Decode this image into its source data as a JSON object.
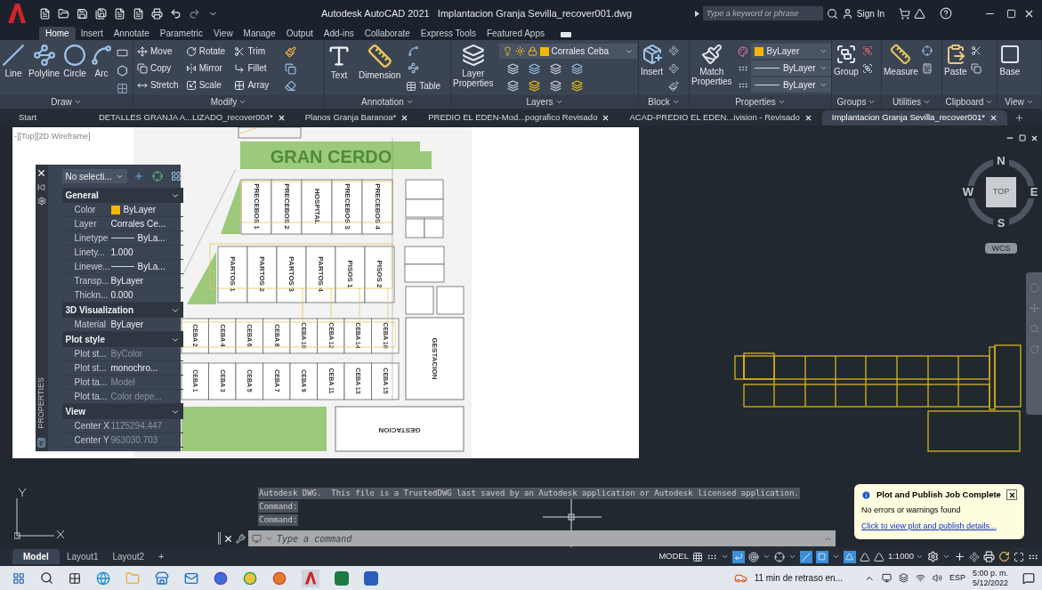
{
  "window": {
    "title": "Autodesk AutoCAD 2021   Implantacion Granja Sevilla_recover001.dwg",
    "search": {
      "placeholder": "Type a keyword or phrase"
    },
    "sign_in": "Sign In"
  },
  "ribbon": {
    "tabs": [
      {
        "label": "Home",
        "selected": true
      },
      {
        "label": "Insert",
        "selected": false
      },
      {
        "label": "Annotate",
        "selected": false
      },
      {
        "label": "Parametric",
        "selected": false
      },
      {
        "label": "View",
        "selected": false
      },
      {
        "label": "Manage",
        "selected": false
      },
      {
        "label": "Output",
        "selected": false
      },
      {
        "label": "Add-ins",
        "selected": false
      },
      {
        "label": "Collaborate",
        "selected": false
      },
      {
        "label": "Express Tools",
        "selected": false
      },
      {
        "label": "Featured Apps",
        "selected": false
      }
    ],
    "panels": [
      {
        "kind": "draw",
        "title": "Draw",
        "tools": [
          "Line",
          "Polyline",
          "Circle",
          "Arc"
        ]
      },
      {
        "kind": "modify",
        "title": "Modify",
        "tools": [
          "Move",
          "Rotate",
          "Trim",
          "Copy",
          "Mirror",
          "Fillet",
          "Stretch",
          "Scale",
          "Array"
        ]
      },
      {
        "kind": "annotation",
        "title": "Annotation",
        "tools": [
          "Text",
          "Dimension",
          "Table"
        ]
      },
      {
        "kind": "layers",
        "title": "Layers",
        "tools": [
          "Layer Properties"
        ],
        "layer": "Corrales Ceba"
      },
      {
        "kind": "block",
        "title": "Block",
        "tools": [
          "Insert"
        ]
      },
      {
        "kind": "properties",
        "title": "Properties",
        "tools": [
          "Match Properties"
        ],
        "dropdowns": [
          "ByLayer",
          "ByLayer",
          "ByLayer"
        ]
      },
      {
        "kind": "groups",
        "title": "Groups",
        "tools": [
          "Group"
        ]
      },
      {
        "kind": "utilities",
        "title": "Utilities",
        "tools": [
          "Measure"
        ]
      },
      {
        "kind": "clipboard",
        "title": "Clipboard",
        "tools": [
          "Paste"
        ]
      },
      {
        "kind": "view",
        "title": "View",
        "tools": [
          "Base"
        ]
      }
    ]
  },
  "file_tabs": [
    {
      "label": "Start",
      "selected": false,
      "closable": false
    },
    {
      "label": "DETALLES GRANJA A...LIZADO_recover004*",
      "selected": false,
      "closable": true
    },
    {
      "label": "Planos Granja Baranoa*",
      "selected": false,
      "closable": true
    },
    {
      "label": "PREDIO EL EDEN-Mod...pografico Revisado",
      "selected": false,
      "closable": true
    },
    {
      "label": "ACAD-PREDIO EL EDEN...ivision - Revisado",
      "selected": false,
      "closable": true
    },
    {
      "label": "Implantacion Granja Sevilla_recover001*",
      "selected": true,
      "closable": true
    }
  ],
  "viewport": {
    "label": "-][Top][2D Wireframe]",
    "plan": {
      "title": "GRAN CERDO",
      "rooms_top": [
        "PRECEBOS 1",
        "PRECEBOS 2",
        "HOSPITAL",
        "PRECEBOS 3",
        "PRECEBOS 4"
      ],
      "rooms_middle": [
        "PARTOS 1",
        "PARTOS 2",
        "PARTOS 3",
        "PARTOS 4",
        "PISOS 1",
        "PISOS 2"
      ],
      "ceba_top": [
        "CEBA 2",
        "CEBA 4",
        "CEBA 6",
        "CEBA 8",
        "CEBA 10",
        "CEBA 12",
        "CEBA 14",
        "CEBA 16"
      ],
      "ceba_bottom": [
        "CEBA 1",
        "CEBA 3",
        "CEBA 5",
        "CEBA 7",
        "CEBA 9",
        "CEBA 11",
        "CEBA 13",
        "CEBA 15"
      ],
      "side_label": "GESTACION",
      "bottom_label": "GESTACION"
    }
  },
  "properties_palette": {
    "title": "PROPERTIES",
    "selection": "No selecti...",
    "sections": [
      {
        "title": "General",
        "expanded": true,
        "rows": [
          {
            "label": "Color",
            "value": "ByLayer",
            "kind": "swatch",
            "disabled": false
          },
          {
            "label": "Layer",
            "value": "Corrales Ce...",
            "kind": "text",
            "disabled": false
          },
          {
            "label": "Linetype",
            "value": "ByLa...",
            "kind": "linetype",
            "disabled": false
          },
          {
            "label": "Linety...",
            "value": "1.000",
            "kind": "text",
            "disabled": false
          },
          {
            "label": "Linewe...",
            "value": "ByLa...",
            "kind": "linetype",
            "disabled": false
          },
          {
            "label": "Transp...",
            "value": "ByLayer",
            "kind": "text",
            "disabled": false
          },
          {
            "label": "Thickn...",
            "value": "0.000",
            "kind": "text",
            "disabled": false
          }
        ]
      },
      {
        "title": "3D Visualization",
        "expanded": true,
        "rows": [
          {
            "label": "Material",
            "value": "ByLayer",
            "kind": "text",
            "disabled": false
          }
        ]
      },
      {
        "title": "Plot style",
        "expanded": true,
        "rows": [
          {
            "label": "Plot st...",
            "value": "ByColor",
            "kind": "text",
            "disabled": true
          },
          {
            "label": "Plot st...",
            "value": "monochro...",
            "kind": "text",
            "disabled": false
          },
          {
            "label": "Plot ta...",
            "value": "Model",
            "kind": "text",
            "disabled": true
          },
          {
            "label": "Plot ta...",
            "value": "Color depe...",
            "kind": "text",
            "disabled": true
          }
        ]
      },
      {
        "title": "View",
        "expanded": true,
        "rows": [
          {
            "label": "Center X",
            "value": "1125294.447",
            "kind": "text",
            "disabled": true
          },
          {
            "label": "Center Y",
            "value": "963030.703",
            "kind": "text",
            "disabled": true
          }
        ]
      }
    ]
  },
  "viewcube": {
    "face": "TOP",
    "directions": [
      "N",
      "W",
      "E",
      "S"
    ],
    "ucs": "WCS"
  },
  "command": {
    "history": [
      "Autodesk DWG.  This file is a TrustedDWG last saved by an Autodesk application or Autodesk licensed application.",
      "Command:",
      "Command:"
    ],
    "placeholder": "Type a command"
  },
  "notification": {
    "title": "Plot and Publish Job Complete",
    "message": "No errors or warnings found",
    "link": "Click to view plot and publish details..."
  },
  "layout_tabs": [
    {
      "label": "Model",
      "selected": true
    },
    {
      "label": "Layout1",
      "selected": false
    },
    {
      "label": "Layout2",
      "selected": false
    }
  ],
  "new_layout": "+",
  "status_bar": {
    "space": "MODEL",
    "scale": "1:1000"
  },
  "taskbar": {
    "news": "11 min de retraso en...",
    "language": "ESP",
    "time": "5:00 p. m.",
    "date": "5/12/2022"
  }
}
